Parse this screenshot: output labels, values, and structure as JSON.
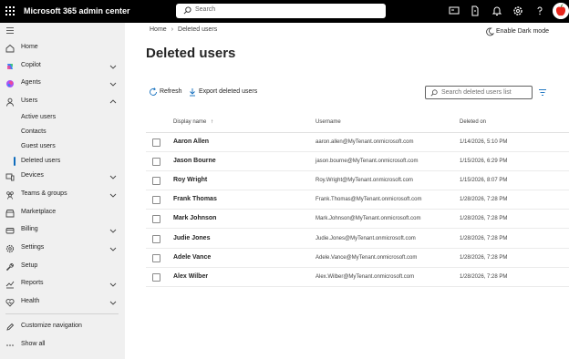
{
  "header": {
    "app_title": "Microsoft 365 admin center",
    "search_placeholder": "Search",
    "icons": [
      "app-launcher-icon",
      "tv-icon",
      "document-icon",
      "bell-icon",
      "gear-icon",
      "help-icon"
    ]
  },
  "sidebar": {
    "items": [
      {
        "label": "Home",
        "icon": "home-icon",
        "chevron": false
      },
      {
        "label": "Copilot",
        "icon": "copilot-icon",
        "chevron": true
      },
      {
        "label": "Agents",
        "icon": "agents-icon",
        "chevron": true
      },
      {
        "label": "Users",
        "icon": "person-icon",
        "chevron": true,
        "expanded": true
      },
      {
        "label": "Devices",
        "icon": "devices-icon",
        "chevron": true
      },
      {
        "label": "Teams & groups",
        "icon": "people-team-icon",
        "chevron": true
      },
      {
        "label": "Marketplace",
        "icon": "marketplace-icon",
        "chevron": false
      },
      {
        "label": "Billing",
        "icon": "billing-icon",
        "chevron": true
      },
      {
        "label": "Settings",
        "icon": "gear-icon",
        "chevron": true
      },
      {
        "label": "Setup",
        "icon": "wrench-icon",
        "chevron": false
      },
      {
        "label": "Reports",
        "icon": "reports-icon",
        "chevron": true
      },
      {
        "label": "Health",
        "icon": "health-icon",
        "chevron": true
      }
    ],
    "users_subitems": [
      "Active users",
      "Contacts",
      "Guest users",
      "Deleted users"
    ],
    "active_subitem": "Deleted users",
    "footer": [
      {
        "label": "Customize navigation",
        "icon": "pencil-icon"
      },
      {
        "label": "Show all",
        "icon": "more-icon"
      }
    ]
  },
  "breadcrumb": [
    "Home",
    "Deleted users"
  ],
  "dark_mode_label": "Enable Dark mode",
  "page_title": "Deleted users",
  "commands": {
    "refresh": "Refresh",
    "export": "Export deleted users",
    "search_placeholder": "Search deleted users list"
  },
  "table": {
    "columns": [
      "Display name",
      "Username",
      "Deleted on"
    ],
    "sort_indicator": "↑",
    "rows": [
      {
        "name": "Aaron Allen",
        "username": "aaron.allen@MyTenant.onmicrosoft.com",
        "deleted_on": "1/14/2026, 5:10 PM"
      },
      {
        "name": "Jason Bourne",
        "username": "jason.bourne@MyTenant.onmicrosoft.com",
        "deleted_on": "1/15/2026, 6:29 PM"
      },
      {
        "name": "Roy Wright",
        "username": "Roy.Wright@MyTenant.onmicrosoft.com",
        "deleted_on": "1/15/2026, 8:07 PM"
      },
      {
        "name": "Frank Thomas",
        "username": "Frank.Thomas@MyTenant.onmicrosoft.com",
        "deleted_on": "1/28/2026, 7:28 PM"
      },
      {
        "name": "Mark Johnson",
        "username": "Mark.Johnson@MyTenant.onmicrosoft.com",
        "deleted_on": "1/28/2026, 7:28 PM"
      },
      {
        "name": "Judie Jones",
        "username": "Judie.Jones@MyTenant.onmicrosoft.com",
        "deleted_on": "1/28/2026, 7:28 PM"
      },
      {
        "name": "Adele Vance",
        "username": "Adele.Vance@MyTenant.onmicrosoft.com",
        "deleted_on": "1/28/2026, 7:28 PM"
      },
      {
        "name": "Alex Wilber",
        "username": "Alex.Wilber@MyTenant.onmicrosoft.com",
        "deleted_on": "1/28/2026, 7:28 PM"
      }
    ]
  },
  "colors": {
    "topbar": "#000000",
    "sidebar": "#f0f0f0",
    "accent": "#0f6cbd",
    "avatar": "#e8261c"
  }
}
